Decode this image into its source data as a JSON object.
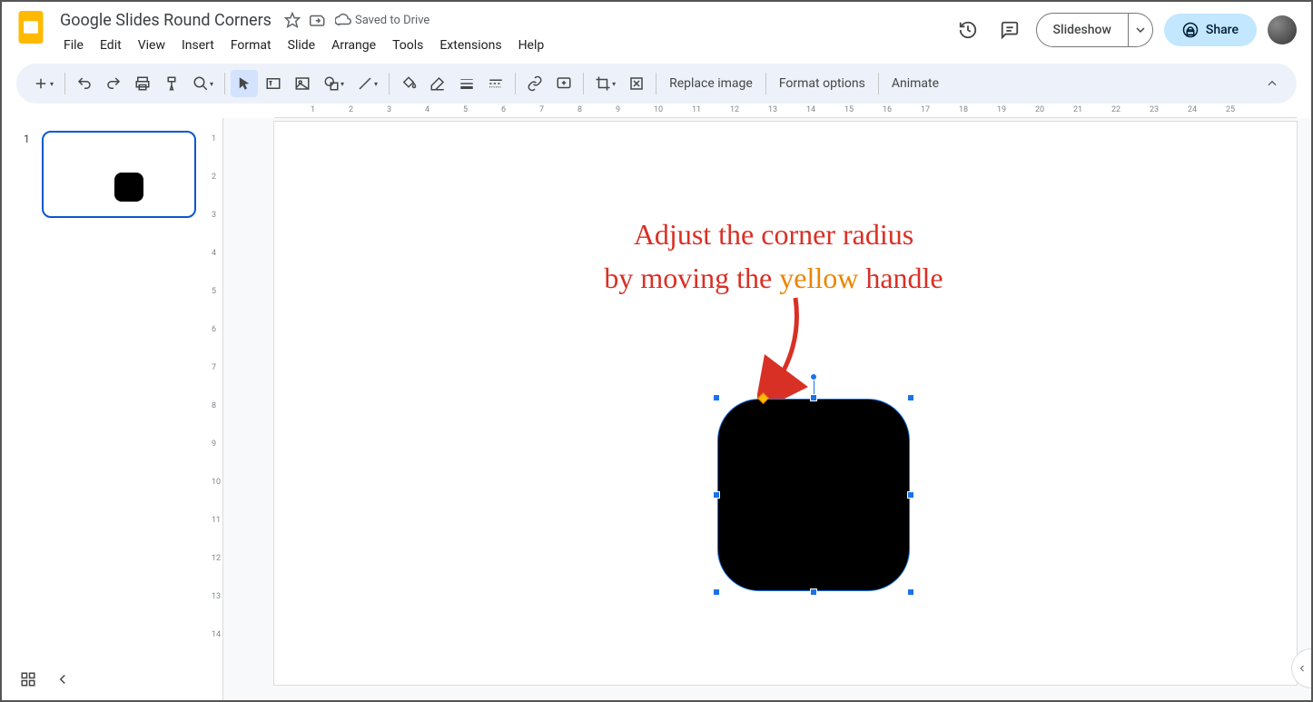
{
  "header": {
    "doc_title": "Google Slides Round Corners",
    "save_status": "Saved to Drive"
  },
  "menus": [
    "File",
    "Edit",
    "View",
    "Insert",
    "Format",
    "Slide",
    "Arrange",
    "Tools",
    "Extensions",
    "Help"
  ],
  "buttons": {
    "slideshow": "Slideshow",
    "share": "Share"
  },
  "toolbar": {
    "replace_image": "Replace image",
    "format_options": "Format options",
    "animate": "Animate"
  },
  "filmstrip": {
    "slide1_num": "1"
  },
  "ruler_x": [
    "1",
    "2",
    "3",
    "4",
    "5",
    "6",
    "7",
    "8",
    "9",
    "10",
    "11",
    "12",
    "13",
    "14",
    "15",
    "16",
    "17",
    "18",
    "19",
    "20",
    "21",
    "22",
    "23",
    "24",
    "25"
  ],
  "ruler_y": [
    "1",
    "2",
    "3",
    "4",
    "5",
    "6",
    "7",
    "8",
    "9",
    "10",
    "11",
    "12",
    "13",
    "14"
  ],
  "annotation": {
    "line1": "Adjust the corner radius",
    "line2a": "by moving the ",
    "line2b": "yellow",
    "line2c": " handle"
  }
}
